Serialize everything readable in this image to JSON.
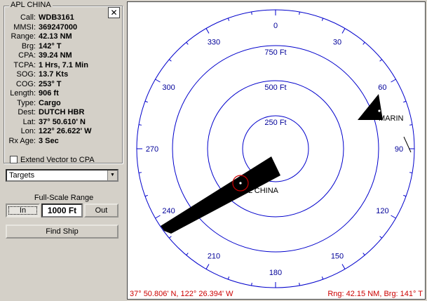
{
  "panel": {
    "title": "APL CHINA",
    "close_label": "✕",
    "rows": [
      {
        "key": "Call:",
        "value": "WDB3161"
      },
      {
        "key": "MMSI:",
        "value": "369247000"
      },
      {
        "key": "Range:",
        "value": "42.13 NM"
      },
      {
        "key": "Brg:",
        "value": "142° T"
      },
      {
        "key": "CPA:",
        "value": "39.24 NM"
      },
      {
        "key": "TCPA:",
        "value": "1 Hrs, 7.1 Min"
      },
      {
        "key": "SOG:",
        "value": "13.7 Kts"
      },
      {
        "key": "COG:",
        "value": "253° T"
      },
      {
        "key": "Length:",
        "value": "906 ft"
      },
      {
        "key": "Type:",
        "value": "Cargo"
      },
      {
        "key": "Dest:",
        "value": "DUTCH HBR"
      },
      {
        "key": "Lat:",
        "value": "37° 50.610' N"
      },
      {
        "key": "Lon:",
        "value": "122° 26.622' W"
      },
      {
        "key": "Rx Age:",
        "value": "3 Sec"
      }
    ],
    "extend_vector_label": "Extend Vector to CPA",
    "extend_vector_checked": false
  },
  "view_select": {
    "selected": "Targets"
  },
  "range": {
    "label": "Full-Scale Range",
    "in_label": "In",
    "value": "1000 Ft",
    "out_label": "Out"
  },
  "find_ship_label": "Find Ship",
  "radar": {
    "bearing_labels": [
      "0",
      "30",
      "60",
      "90",
      "120",
      "150",
      "180",
      "210",
      "240",
      "270",
      "300",
      "330"
    ],
    "ring_labels": [
      "250 Ft",
      "500 Ft",
      "750 Ft"
    ],
    "targets": [
      {
        "name": "APL CHINA",
        "shown_label": "L CHINA"
      },
      {
        "name": "MARIN",
        "shown_label": "MARIN"
      }
    ],
    "cursor_position": "37° 50.806' N, 122° 26.394' W",
    "cursor_range_bearing": "Rng: 42.15 NM, Brg: 141° T",
    "colors": {
      "rings": "#0000cc",
      "labels": "#000099",
      "cursor_text": "#cc0000",
      "selection": "#cc0000",
      "vessel": "#000000"
    }
  }
}
